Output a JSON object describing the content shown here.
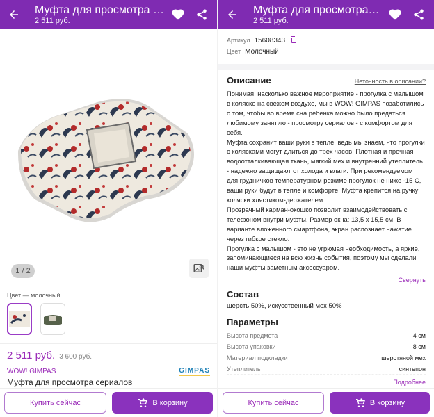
{
  "app_bar": {
    "title": "Муфта для просмотра сериалов",
    "subtitle": "2 511 руб.",
    "icons": [
      "back-arrow-icon",
      "heart-icon",
      "share-icon"
    ]
  },
  "gallery": {
    "counter": "1 / 2",
    "image": "hand-muff-with-bird-print"
  },
  "color": {
    "label": "Цвет — молочный"
  },
  "price": {
    "current": "2 511 руб.",
    "old": "3 600 руб."
  },
  "brand": {
    "name": "WOW! GIMPAS",
    "logo_text": "GIMPAS"
  },
  "product_name": "Муфта для просмотра сериалов",
  "buttons": {
    "buy_now": "Купить сейчас",
    "to_cart": "В корзину"
  },
  "meta": {
    "article_label": "Артикул",
    "article_value": "15608343",
    "color_label": "Цвет",
    "color_value": "Молочный"
  },
  "description": {
    "title": "Описание",
    "report_link": "Неточность в описании?",
    "text": "Понимая, насколько важное мероприятие - прогулка с малышом в коляске на свежем воздухе, мы в WOW! GIMPAS позаботились о том, чтобы во время сна ребенка можно было предаться любимому занятию - просмотру сериалов - с комфортом для себя.\nМуфта сохранит ваши руки в тепле, ведь мы знаем, что прогулки с колясками могут длиться до трех часов. Плотная и прочная водоотталкивающая ткань, мягкий мех и внутренний утеплитель - надежно защищают от холода и влаги. При рекомендуемом для грудничков температурном режиме прогулок не ниже -15 С, ваши руки будут в тепле и комфорте. Муфта крепится на ручку коляски хлястиком-держателем.\nПрозрачный карман-окошко позволит взаимодействовать с телефоном внутри муфты. Размер окна: 13,5 х 15,5 см. В варианте вложенного смартфона, экран распознает нажатие через гибкое стекло.\nПрогулка с малышом - это не угрюмая необходимость, а яркие, запоминающиеся на всю жизнь события, поэтому мы сделали наши муфты заметным аксессуаром.",
    "collapse": "Свернуть"
  },
  "composition": {
    "title": "Состав",
    "value": "шерсть 50%, искусственный мех 50%"
  },
  "parameters": {
    "title": "Параметры",
    "rows": [
      {
        "label": "Высота предмета",
        "value": "4 см"
      },
      {
        "label": "Высота упаковки",
        "value": "8 см"
      },
      {
        "label": "Материал подкладки",
        "value": "шерстяной мех"
      },
      {
        "label": "Утеплитель",
        "value": "синтепон"
      }
    ],
    "more": "Подробнее"
  },
  "colors": {
    "accent": "#7f2bb2",
    "price": "#9a2bb8"
  }
}
